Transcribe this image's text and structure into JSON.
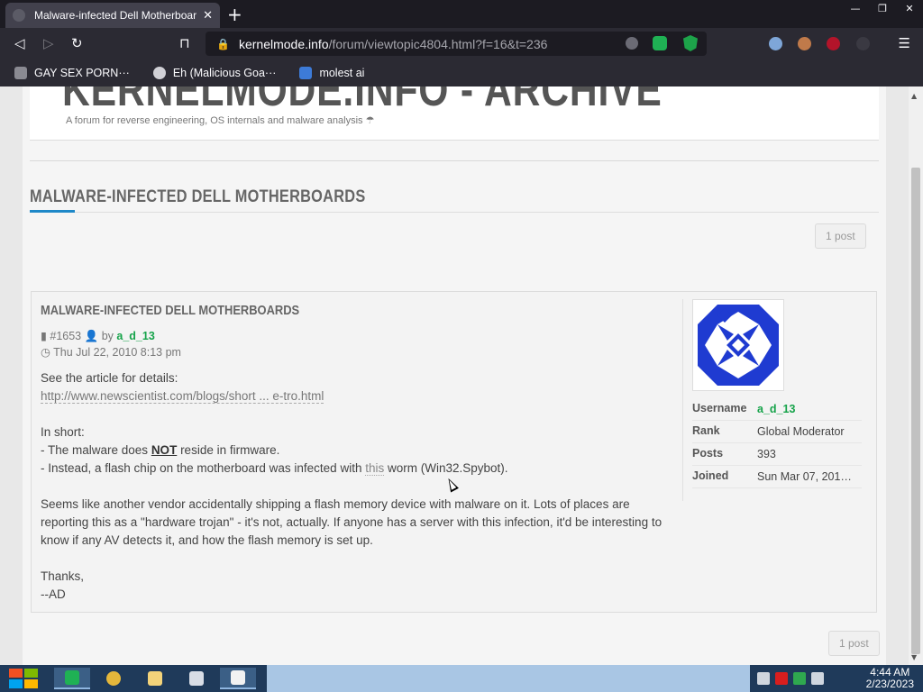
{
  "browser": {
    "tab_title": "Malware-infected Dell Motherboards",
    "tab_close": "✕",
    "new_tab": "+",
    "url_domain": "kernelmode.info",
    "url_path": "/forum/viewtopic4804.html?f=16&t=236",
    "window_controls": {
      "minimize": "—",
      "restore": "❐",
      "close": "✕"
    },
    "nav": {
      "back": "◁",
      "forward": "▷",
      "reload": "↻",
      "bookmark": "⊓",
      "lock": "🔒",
      "menu": "☰"
    },
    "bookmarks": [
      {
        "label": "GAY SEX PORN···",
        "icon": "doc-icon"
      },
      {
        "label": "Eh (Malicious Goa···",
        "icon": "globe-icon"
      },
      {
        "label": "molest ai",
        "icon": "image-icon"
      }
    ]
  },
  "site": {
    "title": "KERNELMODE.INFO - ARCHIVE",
    "description": "A forum for reverse engineering, OS internals and malware analysis ☂"
  },
  "topic": {
    "title": "MALWARE-INFECTED DELL MOTHERBOARDS",
    "pagination_top": "1 post",
    "pagination_bottom": "1 post"
  },
  "post": {
    "title": "MALWARE-INFECTED DELL MOTHERBOARDS",
    "id": "#1653",
    "by": "by",
    "author": "a_d_13",
    "date": "Thu Jul 22, 2010 8:13 pm",
    "line1": "See the article for details:",
    "link": "http://www.newscientist.com/blogs/short ... e-tro.html",
    "in_short": "In short:",
    "bullet1_pre": "- The malware does ",
    "bullet1_em": "NOT",
    "bullet1_post": " reside in firmware.",
    "bullet2_pre": "- Instead, a flash chip on the motherboard was infected with ",
    "bullet2_link": "this",
    "bullet2_post": " worm (Win32.Spybot).",
    "paragraph": "Seems like another vendor accidentally shipping a flash memory device with malware on it. Lots of places are reporting this as a \"hardware trojan\" - it's not, actually. If anyone has a server with this infection, it'd be interesting to know if any AV detects it, and how the flash memory is set up.",
    "thanks": "Thanks,",
    "signature": "--AD"
  },
  "profile": {
    "rows": [
      {
        "key": "Username",
        "value": "a_d_13"
      },
      {
        "key": "Rank",
        "value": "Global Moderator"
      },
      {
        "key": "Posts",
        "value": "393"
      },
      {
        "key": "Joined",
        "value": "Sun Mar 07, 201…"
      }
    ],
    "avatar_colors": {
      "primary": "#1f3bd1",
      "secondary": "#ffffff"
    }
  },
  "scrollbar": {
    "up": "▲",
    "down": "▼"
  },
  "taskbar": {
    "time": "4:44 AM",
    "date": "2/23/2023"
  },
  "colors": {
    "accent": "#1e88c8",
    "author_green": "#16a34a"
  }
}
